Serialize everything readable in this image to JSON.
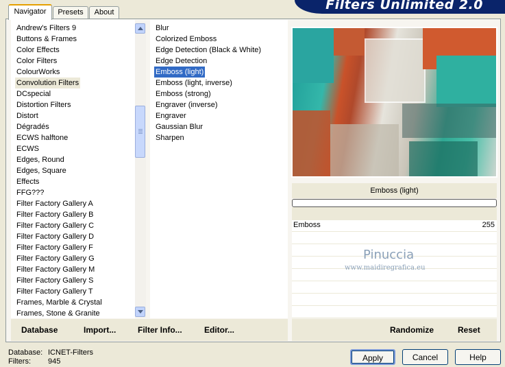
{
  "app": {
    "banner_title": "Filters Unlimited 2.0"
  },
  "tabs": [
    {
      "label": "Navigator",
      "active": true
    },
    {
      "label": "Presets",
      "active": false
    },
    {
      "label": "About",
      "active": false
    }
  ],
  "categories": {
    "items": [
      "Andrew's Filters 9",
      "Buttons & Frames",
      "Color Effects",
      "Color Filters",
      "ColourWorks",
      "Convolution Filters",
      "DCspecial",
      "Distortion Filters",
      "Distort",
      "Dégradés",
      "ECWS halftone",
      "ECWS",
      "Edges, Round",
      "Edges, Square",
      "Effects",
      "FFG???",
      "Filter Factory Gallery A",
      "Filter Factory Gallery B",
      "Filter Factory Gallery C",
      "Filter Factory Gallery D",
      "Filter Factory Gallery F",
      "Filter Factory Gallery G",
      "Filter Factory Gallery M",
      "Filter Factory Gallery S",
      "Filter Factory Gallery T",
      "Frames, Marble & Crystal",
      "Frames, Stone & Granite"
    ],
    "selected": "Convolution Filters"
  },
  "filters": {
    "items": [
      "Blur",
      "Colorized Emboss",
      "Edge Detection (Black & White)",
      "Edge Detection",
      "Emboss (light)",
      "Emboss (light, inverse)",
      "Emboss (strong)",
      "Engraver (inverse)",
      "Engraver",
      "Gaussian Blur",
      "Sharpen"
    ],
    "selected": "Emboss (light)"
  },
  "left_buttons": {
    "database": "Database",
    "import": "Import...",
    "filter_info": "Filter Info...",
    "editor": "Editor..."
  },
  "filter_panel": {
    "current_filter": "Emboss (light)",
    "progress": 0,
    "params": [
      {
        "name": "Emboss",
        "value": "255"
      }
    ],
    "randomize": "Randomize",
    "reset": "Reset"
  },
  "watermark": {
    "name": "Pinuccia",
    "url": "www.maidiregrafica.eu"
  },
  "status": {
    "database_label": "Database:",
    "database_value": "ICNET-Filters",
    "filters_label": "Filters:",
    "filters_value": "945"
  },
  "dialog_buttons": {
    "apply": "Apply",
    "cancel": "Cancel",
    "help": "Help"
  },
  "colors": {
    "selection": "#316ac5",
    "banner": "#0a246a",
    "tab_accent": "#e5a000"
  }
}
